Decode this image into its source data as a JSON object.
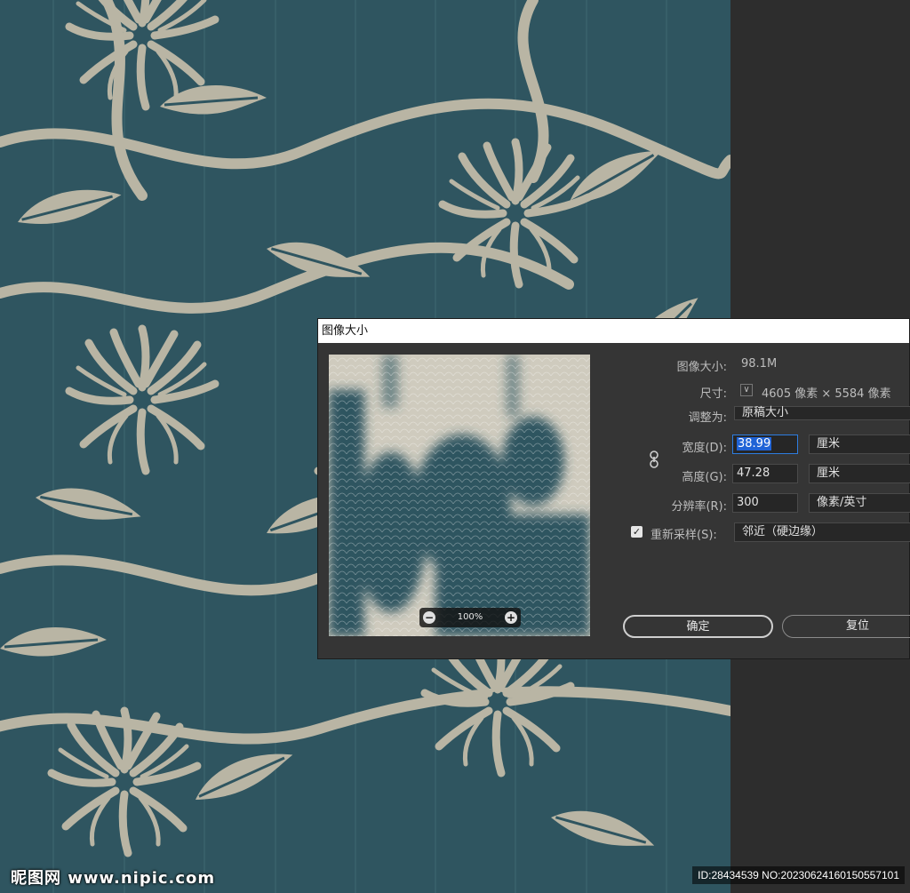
{
  "dialog": {
    "title": "图像大小",
    "image_size_label": "图像大小:",
    "image_size_value": "98.1M",
    "dimensions_label": "尺寸:",
    "dimensions_value": "4605 像素 × 5584 像素",
    "fit_to_label": "调整为:",
    "fit_to_value": "原稿大小",
    "width_label": "宽度(D):",
    "width_value": "38.99",
    "width_unit": "厘米",
    "height_label": "高度(G):",
    "height_value": "47.28",
    "height_unit": "厘米",
    "resolution_label": "分辨率(R):",
    "resolution_value": "300",
    "resolution_unit": "像素/英寸",
    "resample_label": "重新采样(S):",
    "resample_checked": true,
    "resample_value": "邻近（硬边缘）",
    "zoom_value": "100%",
    "ok_label": "确定",
    "reset_label": "复位"
  },
  "icons": {
    "dimensions_toggle": "chevron-down-icon",
    "constrain": "chain-link-icon",
    "zoom_out": "zoom-out-icon",
    "zoom_in": "zoom-in-icon",
    "checkbox": "checkmark-icon"
  },
  "watermark": {
    "logo": "昵图网 www.nipic.com",
    "id_text": "ID:28434539 NO:20230624160150557101"
  },
  "colors": {
    "fabric_dark": "#2f5560",
    "fabric_light": "#b9b5a4",
    "dialog_bg": "#353535",
    "accent": "#2d7de0"
  }
}
